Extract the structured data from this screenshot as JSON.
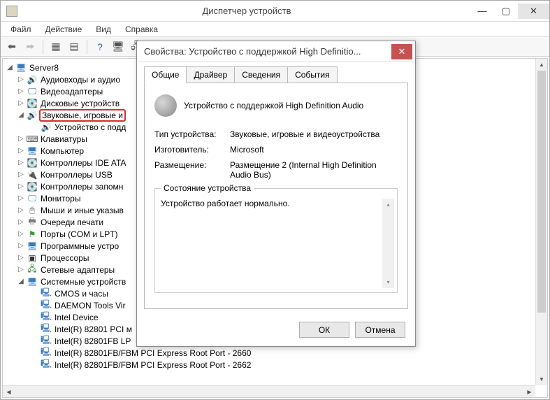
{
  "window": {
    "title": "Диспетчер устройств"
  },
  "menu": {
    "file": "Файл",
    "action": "Действие",
    "view": "Вид",
    "help": "Справка"
  },
  "tree": {
    "root": "Server8",
    "items": [
      {
        "label": "Аудиовходы и аудио",
        "icon": "audio",
        "expander": "▷"
      },
      {
        "label": "Видеоадаптеры",
        "icon": "display",
        "expander": "▷"
      },
      {
        "label": "Дисковые устройств",
        "icon": "disk",
        "expander": "▷"
      },
      {
        "label": "Звуковые, игровые и",
        "icon": "audio",
        "expander": "◢",
        "highlighted": true,
        "children": [
          {
            "label": "Устройство с подд",
            "icon": "audio"
          }
        ]
      },
      {
        "label": "Клавиатуры",
        "icon": "keyboard",
        "expander": "▷"
      },
      {
        "label": "Компьютер",
        "icon": "computer",
        "expander": "▷"
      },
      {
        "label": "Контроллеры IDE ATA",
        "icon": "disk",
        "expander": "▷"
      },
      {
        "label": "Контроллеры USB",
        "icon": "usb",
        "expander": "▷"
      },
      {
        "label": "Контроллеры запомн",
        "icon": "disk",
        "expander": "▷"
      },
      {
        "label": "Мониторы",
        "icon": "monitor",
        "expander": "▷"
      },
      {
        "label": "Мыши и иные указыв",
        "icon": "mouse",
        "expander": "▷"
      },
      {
        "label": "Очереди печати",
        "icon": "printer",
        "expander": "▷"
      },
      {
        "label": "Порты (COM и LPT)",
        "icon": "port",
        "expander": "▷"
      },
      {
        "label": "Программные устро",
        "icon": "system",
        "expander": "▷"
      },
      {
        "label": "Процессоры",
        "icon": "cpu",
        "expander": "▷"
      },
      {
        "label": "Сетевые адаптеры",
        "icon": "network",
        "expander": "▷"
      },
      {
        "label": "Системные устройств",
        "icon": "system",
        "expander": "◢",
        "children": [
          {
            "label": "CMOS и часы",
            "icon": "chip"
          },
          {
            "label": "DAEMON Tools Vir",
            "icon": "chip"
          },
          {
            "label": "Intel Device",
            "icon": "chip"
          },
          {
            "label": "Intel(R) 82801 PCI м",
            "icon": "chip"
          },
          {
            "label": "Intel(R) 82801FB LP",
            "icon": "chip"
          },
          {
            "label": "Intel(R) 82801FB/FBM PCI Express Root Port - 2660",
            "icon": "chip"
          },
          {
            "label": "Intel(R) 82801FB/FBM PCI Express Root Port - 2662",
            "icon": "chip"
          }
        ]
      }
    ]
  },
  "dialog": {
    "title": "Свойства: Устройство с поддержкой High Definitio...",
    "tabs": {
      "general": "Общие",
      "driver": "Драйвер",
      "details": "Сведения",
      "events": "События"
    },
    "device_name": "Устройство с поддержкой High Definition Audio",
    "type_label": "Тип устройства:",
    "type_value": "Звуковые, игровые и видеоустройства",
    "mfr_label": "Изготовитель:",
    "mfr_value": "Microsoft",
    "loc_label": "Размещение:",
    "loc_value": "Размещение 2 (Internal High Definition Audio Bus)",
    "status_legend": "Состояние устройства",
    "status_text": "Устройство работает нормально.",
    "ok": "ОК",
    "cancel": "Отмена"
  }
}
